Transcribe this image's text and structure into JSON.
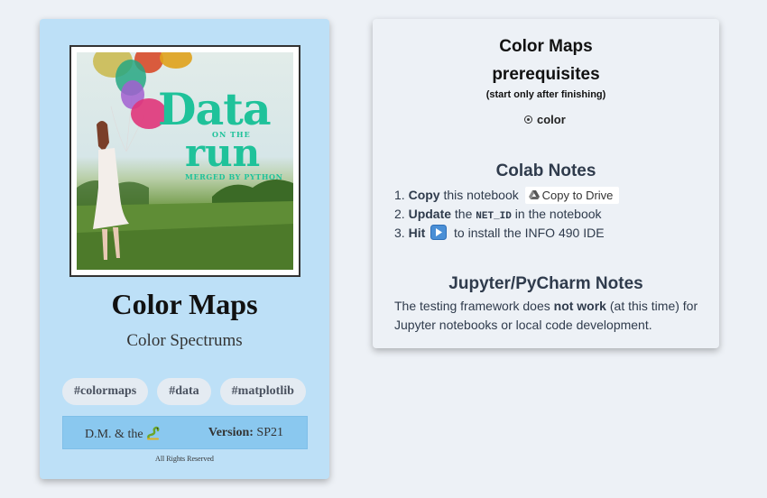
{
  "card": {
    "cover": {
      "title_word": "Data",
      "on_the": "ON THE",
      "run_word": "run",
      "merged_by": "MERGED BY PYTHON"
    },
    "title": "Color Maps",
    "subtitle": "Color Spectrums",
    "tags": [
      "#colormaps",
      "#data",
      "#matplotlib"
    ],
    "author": "D.M. & the",
    "version_label": "Version:",
    "version_value": "SP21",
    "rights": "All Rights Reserved",
    "icons": {
      "author_icon": "snake-icon"
    }
  },
  "panel": {
    "title_line1": "Color Maps",
    "title_line2": "prerequisites",
    "note": "(start only after finishing)",
    "prerequisite": "color",
    "colab_heading": "Colab Notes",
    "steps": {
      "s1_num": "1.",
      "s1_bold": "Copy",
      "s1_text": "this notebook",
      "s1_button": "Copy to Drive",
      "s2_num": "2.",
      "s2_bold": "Update",
      "s2_text_a": "the",
      "s2_code": "NET_ID",
      "s2_text_b": "in the notebook",
      "s3_num": "3.",
      "s3_bold": "Hit",
      "s3_text": "to install the INFO 490 IDE"
    },
    "jupyter_heading": "Jupyter/PyCharm Notes",
    "jupyter_text_a": "The testing framework does",
    "jupyter_bold": "not work",
    "jupyter_text_b": "(at this time) for Jupyter notebooks or local code development."
  },
  "colors": {
    "card_bg": "#bde0f7",
    "footer_bar": "#8ac8ef",
    "page_bg": "#edf1f6",
    "cover_text": "#1fc29a",
    "play_button": "#4a8fd6"
  }
}
